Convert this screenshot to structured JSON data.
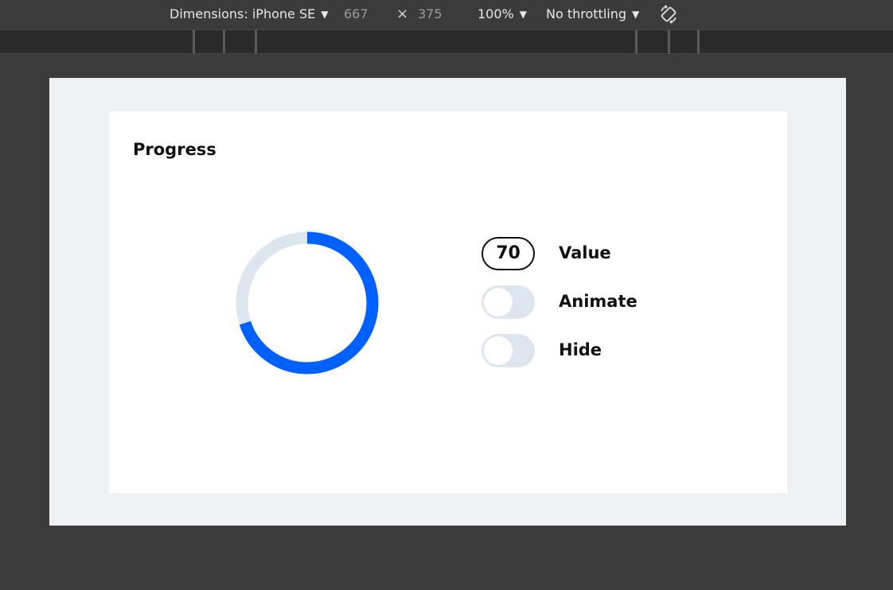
{
  "devtools": {
    "dimensions_label": "Dimensions: iPhone SE",
    "width": "667",
    "times": "×",
    "height": "375",
    "zoom": "100%",
    "throttling": "No throttling",
    "caret": "▼"
  },
  "card": {
    "title": "Progress"
  },
  "progress": {
    "value": 70,
    "percent": 0.7,
    "ring_color": "#0061ff",
    "track_color": "#dde5ee"
  },
  "controls": {
    "value_display": "70",
    "value_label": "Value",
    "animate_label": "Animate",
    "animate_on": false,
    "hide_label": "Hide",
    "hide_on": false
  }
}
